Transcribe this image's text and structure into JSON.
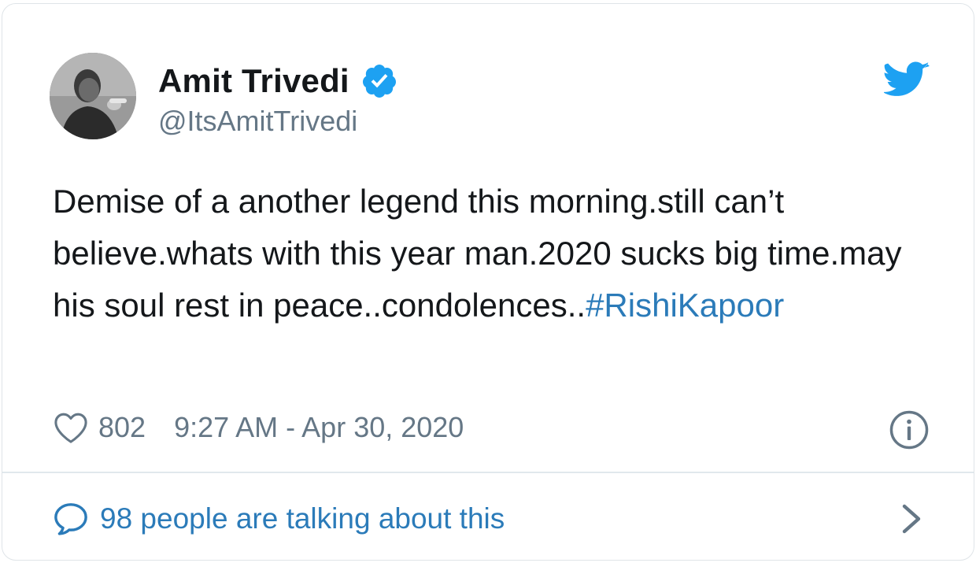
{
  "author": {
    "name": "Amit Trivedi",
    "handle": "@ItsAmitTrivedi",
    "verified": true
  },
  "tweet": {
    "text": "Demise of a another legend this morning.still can’t believe.whats with this year man.2020 sucks big time.may his soul rest in peace..condolences..",
    "hashtag": "#RishiKapoor"
  },
  "meta": {
    "like_count": "802",
    "timestamp": "9:27 AM - Apr 30, 2020"
  },
  "footer": {
    "label": "98 people are talking about this"
  },
  "icons": {
    "logo": "twitter-bird-icon",
    "verified": "verified-badge-icon",
    "like": "heart-icon",
    "info": "info-icon",
    "reply": "speech-bubble-icon",
    "chevron": "chevron-right-icon"
  },
  "colors": {
    "brand": "#1da1f2",
    "link": "#2b7bb9",
    "text": "#14171a",
    "secondary": "#657786",
    "border": "#dfe4e8"
  }
}
